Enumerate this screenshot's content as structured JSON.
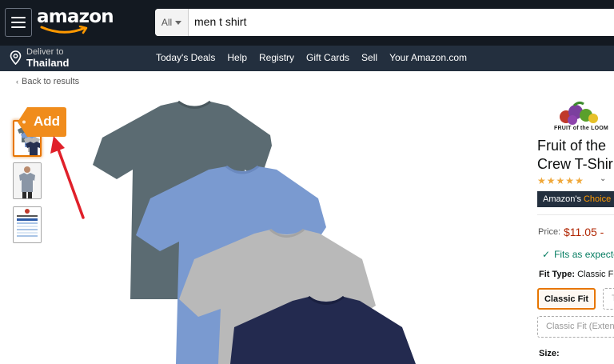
{
  "header": {
    "logo_text": "amazon",
    "search": {
      "category": "All",
      "query": "men t shirt"
    },
    "deliver": {
      "line1": "Deliver to",
      "line2": "Thailand"
    },
    "nav": [
      "Today's Deals",
      "Help",
      "Registry",
      "Gift Cards",
      "Sell",
      "Your Amazon.com"
    ]
  },
  "breadcrumb": {
    "back": "Back to results"
  },
  "annotation": {
    "add_label": "Add"
  },
  "product": {
    "brand_logo_text": "FRUIT of the LOOM",
    "title_line1": "Fruit of the",
    "title_line2": "Crew T-Shir",
    "rating": 4.5,
    "badge": {
      "prefix": "Amazon's",
      "suffix": "Choice"
    },
    "price_label": "Price:",
    "price": "$11.05 -",
    "fits_text": "Fits as expecte",
    "fit_type_label": "Fit Type:",
    "fit_type_value": "Classic Fi",
    "fit_options": [
      "Classic Fit",
      "T",
      "Classic Fit (Exten"
    ],
    "size_label": "Size:"
  },
  "colors": {
    "header_bg": "#131921",
    "subheader_bg": "#232f3e",
    "accent_orange": "#ff9900",
    "price_red": "#b12704",
    "fits_green": "#067d62",
    "arrow_red": "#e0202a"
  }
}
